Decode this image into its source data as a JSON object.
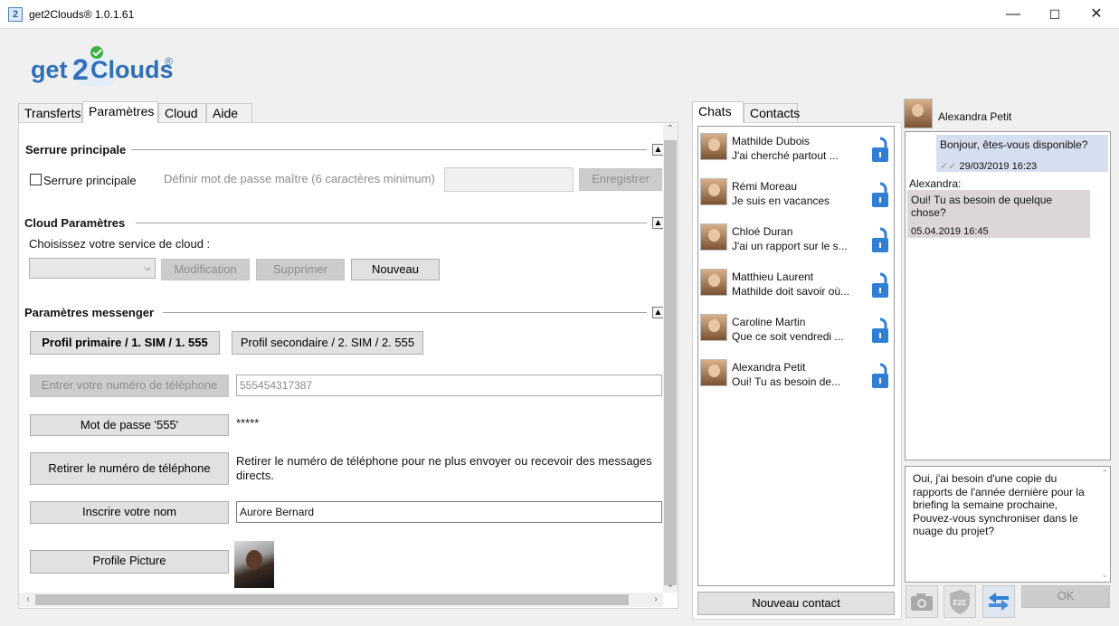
{
  "window": {
    "title": "get2Clouds® 1.0.1.61",
    "icon_glyph": "2",
    "min": "—",
    "max": "☐",
    "close": "✕"
  },
  "logo": {
    "text_pre": "get",
    "text_num": "2",
    "text_post": "Clouds",
    "reg": "®"
  },
  "tabs": [
    "Transferts",
    "Paramètres",
    "Cloud",
    "Aide"
  ],
  "lock_section": {
    "title": "Serrure principale",
    "checkbox_label": "Serrure principale",
    "hint": "Définir mot de passe maître (6 caractères minimum)",
    "save": "Enregistrer"
  },
  "cloud_section": {
    "title": "Cloud Paramètres",
    "prompt": "Choisissez votre service de cloud :",
    "modify": "Modification",
    "delete": "Supprimer",
    "new": "Nouveau"
  },
  "messenger_section": {
    "title": "Paramètres messenger",
    "profile_primary": "Profil primaire / 1. SIM / 1. 555",
    "profile_secondary": "Profil secondaire / 2. SIM / 2. 555",
    "enter_phone": "Entrer votre numéro de téléphone",
    "phone_value": "555454317387",
    "password_btn": "Mot de passe '555'",
    "password_mask": "*****",
    "remove_phone": "Retirer le numéro de téléphone",
    "remove_desc": "Retirer le numéro de téléphone pour ne plus envoyer ou recevoir des messages directs.",
    "register_name": "Inscrire votre nom",
    "name_value": "Aurore Bernard",
    "profile_picture": "Profile Picture"
  },
  "chat_tabs": [
    "Chats",
    "Contacts"
  ],
  "chats": [
    {
      "name": "Mathilde Dubois",
      "snippet": "J'ai cherché partout ..."
    },
    {
      "name": "Rémi Moreau",
      "snippet": "Je suis en vacances"
    },
    {
      "name": "Chloé Duran",
      "snippet": "J'ai un rapport sur le s..."
    },
    {
      "name": "Matthieu Laurent",
      "snippet": "Mathilde doit savoir où..."
    },
    {
      "name": "Caroline Martin",
      "snippet": "Que ce soit vendredi ..."
    },
    {
      "name": "Alexandra Petit",
      "snippet": "Oui! Tu as besoin de..."
    }
  ],
  "new_contact": "Nouveau contact",
  "conversation": {
    "contact_name": "Alexandra Petit",
    "outgoing_text": "Bonjour, êtes-vous disponible?",
    "outgoing_time": "29/03/2019 16:23",
    "sender_label": "Alexandra:",
    "incoming_text": "Oui! Tu as besoin de quelque chose?",
    "incoming_time": "05.04.2019 16:45",
    "draft": "Oui, j'ai besoin d'une copie du rapports de l'année dernière pour la briefing la semaine prochaine, Pouvez-vous synchroniser dans le nuage du projet?",
    "ok": "OK",
    "e2e": "E2E"
  },
  "colors": {
    "accent": "#1a73e8",
    "logo_blue": "#2f6fb8",
    "bubble_out": "#d5dff0",
    "bubble_in": "#ddd6d6",
    "lock": "#2f7fd6"
  }
}
